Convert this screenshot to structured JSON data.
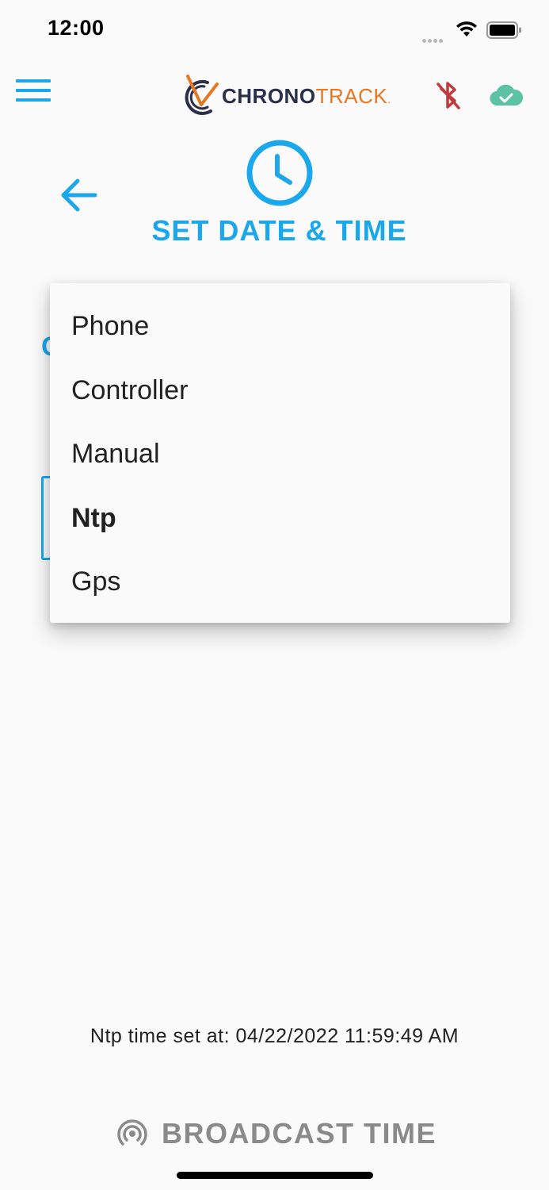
{
  "status_bar": {
    "time": "12:00"
  },
  "header": {
    "logo_chrono": "CHRONO",
    "logo_track": "TRACK",
    "logo_mark": "."
  },
  "page": {
    "title": "SET DATE & TIME"
  },
  "dropdown": {
    "selected": "Ntp",
    "options": [
      {
        "label": "Phone"
      },
      {
        "label": "Controller"
      },
      {
        "label": "Manual"
      },
      {
        "label": "Ntp"
      },
      {
        "label": "Gps"
      }
    ]
  },
  "footer": {
    "ntp_status": "Ntp time set at: 04/22/2022 11:59:49 AM",
    "broadcast_label": "BROADCAST TIME"
  },
  "colors": {
    "accent": "#1aa7ec",
    "bluetooth_off": "#c0393b",
    "cloud_ok": "#5bc2a3",
    "logo_orange": "#e87722",
    "logo_navy": "#2a2f4a",
    "disabled_text": "#8a8a8a"
  },
  "icons": {
    "menu": "hamburger-menu-icon",
    "bluetooth": "bluetooth-disabled-icon",
    "cloud": "cloud-check-icon",
    "back": "arrow-left-icon",
    "clock": "clock-icon",
    "broadcast": "broadcast-icon"
  }
}
